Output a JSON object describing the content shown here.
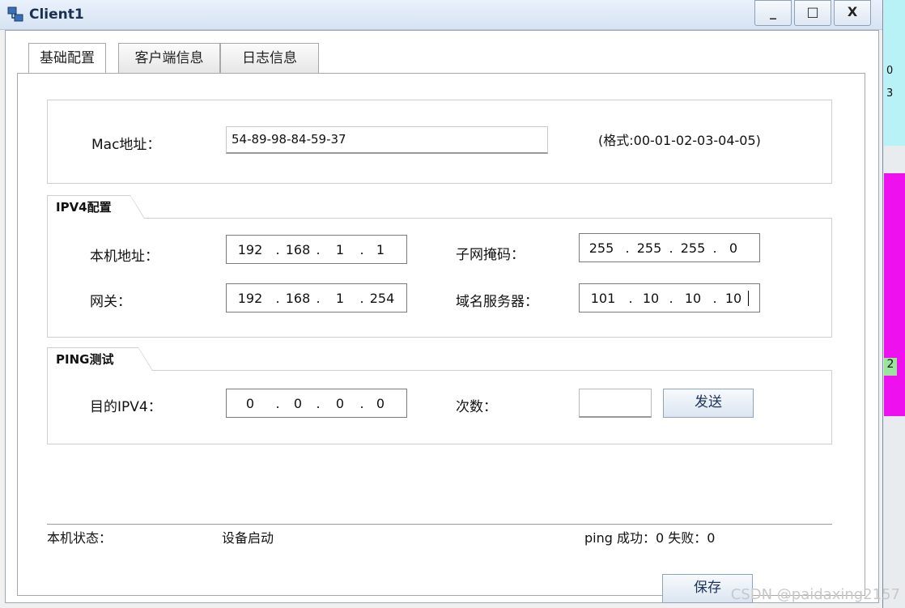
{
  "window": {
    "title": "Client1",
    "min_label": "_",
    "max_label": "□",
    "close_label": "X"
  },
  "tabs": [
    {
      "label": "基础配置"
    },
    {
      "label": "客户端信息"
    },
    {
      "label": "日志信息"
    }
  ],
  "mac": {
    "label": "Mac地址：",
    "value": "54-89-98-84-59-37",
    "hint": "(格式:00-01-02-03-04-05)"
  },
  "ipv4": {
    "section_title": "IPV4配置",
    "local_label": "本机地址：",
    "local": [
      "192",
      "168",
      "1",
      "1"
    ],
    "mask_label": "子网掩码：",
    "mask": [
      "255",
      "255",
      "255",
      "0"
    ],
    "gateway_label": "网关：",
    "gateway": [
      "192",
      "168",
      "1",
      "254"
    ],
    "dns_label": "域名服务器：",
    "dns": [
      "101",
      "10",
      "10",
      "10"
    ]
  },
  "ping": {
    "section_title": "PING测试",
    "dest_label": "目的IPV4：",
    "dest": [
      "0",
      "0",
      "0",
      "0"
    ],
    "count_label": "次数：",
    "count": "",
    "send_label": "发送"
  },
  "status": {
    "label": "本机状态：",
    "value": "设备启动",
    "ping_result": "ping 成功：0 失败：0"
  },
  "save_label": "保存",
  "sidebar_right": {
    "texts": [
      "0",
      "3",
      "2"
    ]
  },
  "watermark": "CSDN @paidaxing2157"
}
